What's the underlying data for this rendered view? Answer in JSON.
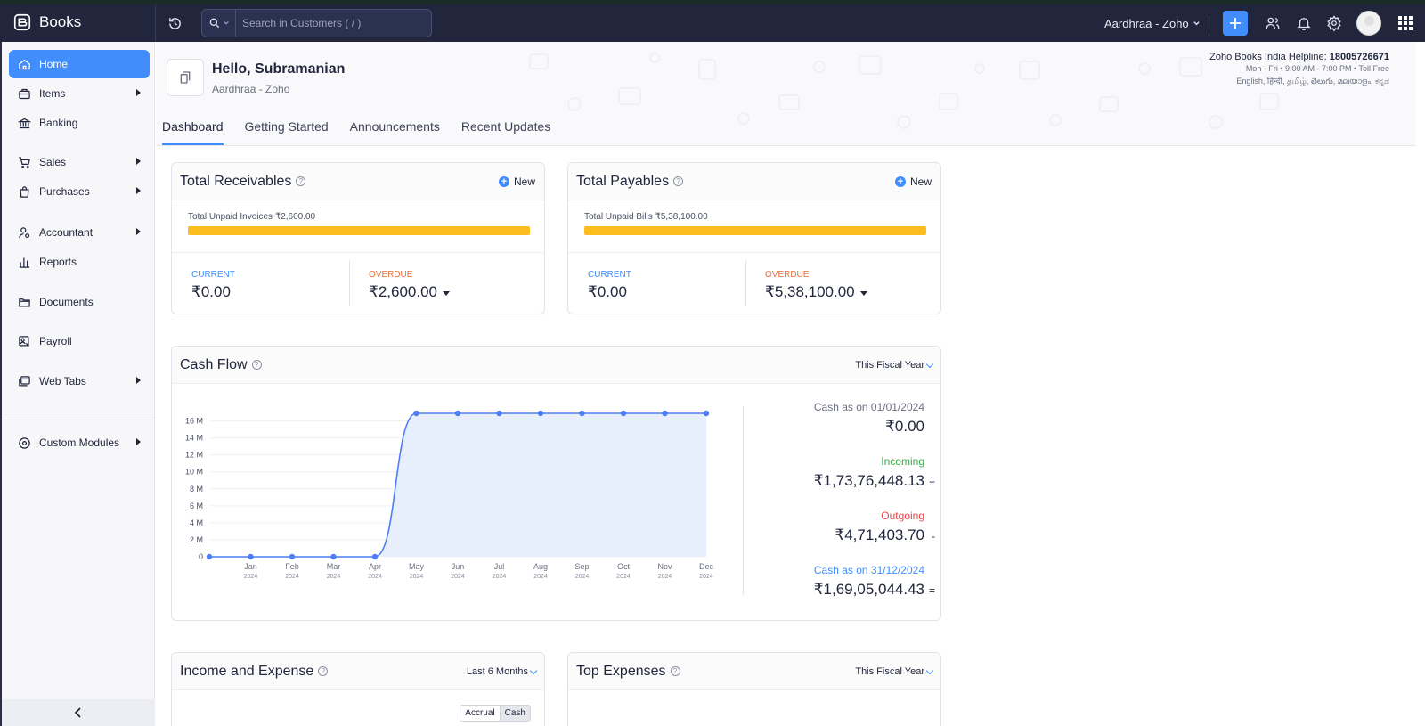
{
  "app": {
    "name": "Books",
    "org_switcher": "Aardhraa - Zoho"
  },
  "search": {
    "placeholder": "Search in Customers ( / )"
  },
  "sidebar": {
    "items": [
      {
        "label": "Home",
        "icon": "home-icon"
      },
      {
        "label": "Items",
        "icon": "items-icon"
      },
      {
        "label": "Banking",
        "icon": "bank-icon"
      },
      {
        "label": "Sales",
        "icon": "cart-icon"
      },
      {
        "label": "Purchases",
        "icon": "bag-icon"
      },
      {
        "label": "Accountant",
        "icon": "accountant-icon"
      },
      {
        "label": "Reports",
        "icon": "reports-icon"
      },
      {
        "label": "Documents",
        "icon": "folder-icon"
      },
      {
        "label": "Payroll",
        "icon": "payroll-icon"
      },
      {
        "label": "Web Tabs",
        "icon": "webtabs-icon"
      },
      {
        "label": "Custom Modules",
        "icon": "modules-icon"
      }
    ]
  },
  "header": {
    "greeting": "Hello, Subramanian",
    "org": "Aardhraa - Zoho",
    "helpline_label": "Zoho Books India Helpline:",
    "helpline_number": "18005726671",
    "hours": "Mon - Fri • 9:00 AM - 7:00 PM • Toll Free",
    "languages": "English, हिन्दी, தமிழ், తెలుగు, മലയാളം, ಕನ್ನಡ"
  },
  "tabs": [
    "Dashboard",
    "Getting Started",
    "Announcements",
    "Recent Updates"
  ],
  "receivables": {
    "title": "Total Receivables",
    "new_label": "New",
    "unpaid_label": "Total Unpaid Invoices ₹2,600.00",
    "current_label": "CURRENT",
    "current_value": "₹0.00",
    "overdue_label": "OVERDUE",
    "overdue_value": "₹2,600.00",
    "overdue_fraction": 1.0
  },
  "payables": {
    "title": "Total Payables",
    "new_label": "New",
    "unpaid_label": "Total Unpaid Bills ₹5,38,100.00",
    "current_label": "CURRENT",
    "current_value": "₹0.00",
    "overdue_label": "OVERDUE",
    "overdue_value": "₹5,38,100.00",
    "overdue_fraction": 1.0
  },
  "cashflow": {
    "title": "Cash Flow",
    "period": "This Fiscal Year",
    "opening_label": "Cash as on 01/01/2024",
    "opening_value": "₹0.00",
    "incoming_label": "Incoming",
    "incoming_value": "₹1,73,76,448.13",
    "incoming_sign": "+",
    "outgoing_label": "Outgoing",
    "outgoing_value": "₹4,71,403.70",
    "outgoing_sign": "-",
    "closing_label": "Cash as on 31/12/2024",
    "closing_value": "₹1,69,05,044.43",
    "closing_sign": "=",
    "colors": {
      "incoming": "#3aa84a",
      "outgoing": "#e5484d",
      "closing": "#408dfb",
      "line": "#4e7df5",
      "fill": "#e8effc"
    }
  },
  "income_expense": {
    "title": "Income and Expense",
    "period": "Last 6 Months",
    "toggle": [
      "Accrual",
      "Cash"
    ]
  },
  "top_expenses": {
    "title": "Top Expenses",
    "period": "This Fiscal Year"
  },
  "chart_data": {
    "type": "area",
    "x": [
      "Jan",
      "Feb",
      "Mar",
      "Apr",
      "May",
      "Jun",
      "Jul",
      "Aug",
      "Sep",
      "Oct",
      "Nov",
      "Dec"
    ],
    "x_sub": [
      "2024",
      "2024",
      "2024",
      "2024",
      "2024",
      "2024",
      "2024",
      "2024",
      "2024",
      "2024",
      "2024",
      "2024"
    ],
    "series": [
      {
        "values": [
          0,
          0,
          0,
          0,
          0,
          16.9,
          16.9,
          16.9,
          16.9,
          16.9,
          16.9,
          16.9,
          16.9
        ]
      }
    ],
    "ytick_labels": [
      "0",
      "2 M",
      "4 M",
      "6 M",
      "8 M",
      "10 M",
      "12 M",
      "14 M",
      "16 M"
    ],
    "ylim": [
      0,
      16.9
    ],
    "grid": true
  }
}
